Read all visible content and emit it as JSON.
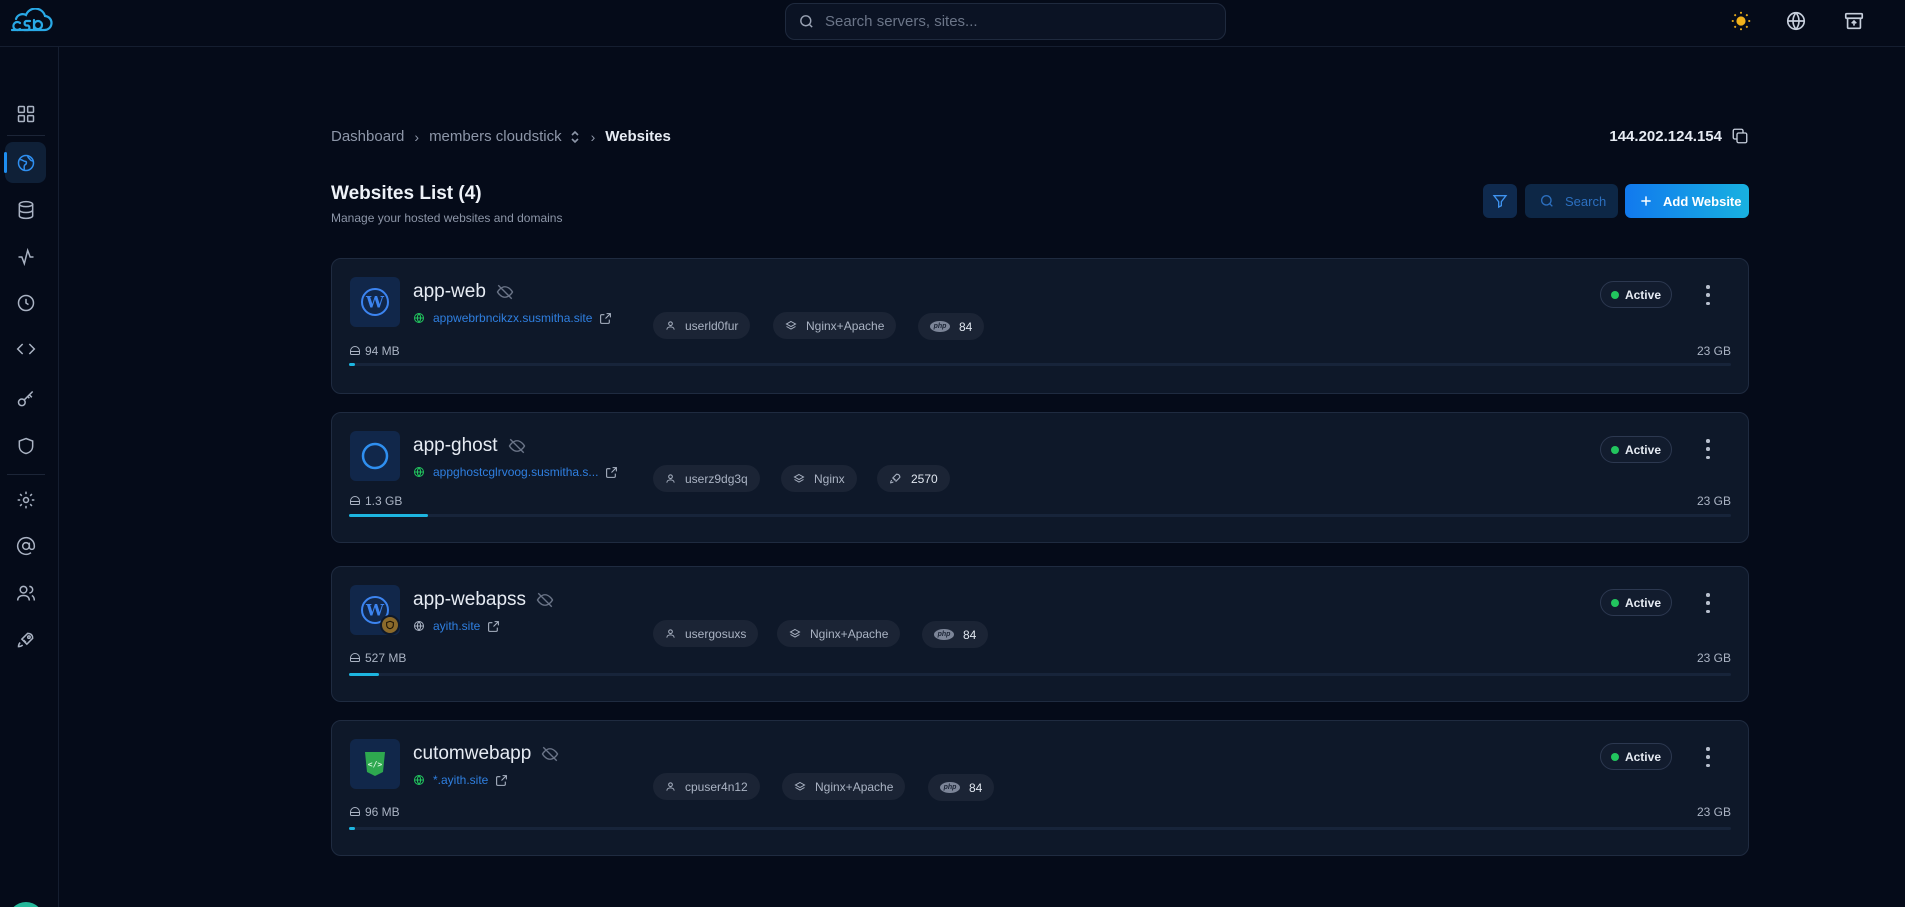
{
  "search": {
    "placeholder": "Search servers, sites..."
  },
  "breadcrumb": {
    "dashboard": "Dashboard",
    "server": "members cloudstick",
    "current": "Websites"
  },
  "server_ip": "144.202.124.154",
  "page": {
    "title": "Websites List (4)",
    "subtitle": "Manage your hosted websites and domains",
    "search_label": "Search",
    "add_label": "Add Website"
  },
  "colors": {
    "accent": "#1e8ef0",
    "active": "#22c55e",
    "progress": "#1db5e0"
  },
  "websites": [
    {
      "name": "app-web",
      "domain": "appwebrbncikzx.susmitha.site",
      "icon": "wordpress-icon",
      "user": "userld0fur",
      "stack": "Nginx+Apache",
      "runtime_icon": "php-icon",
      "runtime": "84",
      "status": "Active",
      "used": "94 MB",
      "total": "23 GB",
      "usage_fraction": 0.004
    },
    {
      "name": "app-ghost",
      "domain": "appghostcglrvoog.susmitha.s...",
      "icon": "ghost-icon",
      "user": "userz9dg3q",
      "stack": "Nginx",
      "runtime_icon": "rocket-icon",
      "runtime": "2570",
      "status": "Active",
      "used": "1.3 GB",
      "total": "23 GB",
      "usage_fraction": 0.057
    },
    {
      "name": "app-webapss",
      "domain": "ayith.site",
      "icon": "wordpress-icon",
      "user": "usergosuxs",
      "stack": "Nginx+Apache",
      "runtime_icon": "php-icon",
      "runtime": "84",
      "status": "Active",
      "used": "527 MB",
      "total": "23 GB",
      "usage_fraction": 0.022
    },
    {
      "name": "cutomwebapp",
      "domain": "*.ayith.site",
      "icon": "html5-icon",
      "user": "cpuser4n12",
      "stack": "Nginx+Apache",
      "runtime_icon": "php-icon",
      "runtime": "84",
      "status": "Active",
      "used": "96 MB",
      "total": "23 GB",
      "usage_fraction": 0.004
    }
  ]
}
